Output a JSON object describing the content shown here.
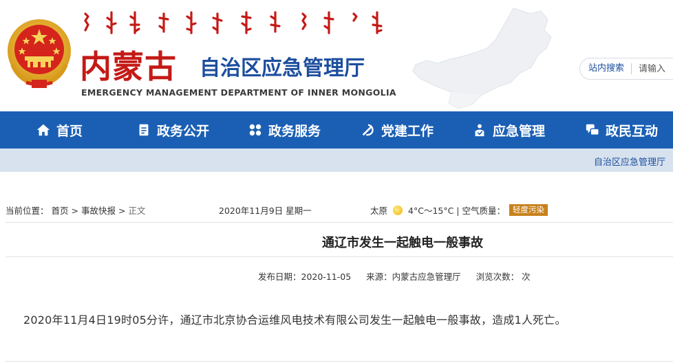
{
  "header": {
    "logo_cn": "内蒙古",
    "logo_sub": "自治区应急管理厅",
    "logo_en": "EMERGENCY MANAGEMENT DEPARTMENT OF INNER MONGOLIA",
    "search_label": "站内搜索",
    "search_placeholder": "请输入"
  },
  "nav": {
    "items": [
      {
        "label": "首页",
        "icon": "home-icon"
      },
      {
        "label": "政务公开",
        "icon": "document-icon"
      },
      {
        "label": "政务服务",
        "icon": "grid-icon"
      },
      {
        "label": "党建工作",
        "icon": "party-emblem-icon"
      },
      {
        "label": "应急管理",
        "icon": "shield-person-icon"
      },
      {
        "label": "政民互动",
        "icon": "chat-icon"
      }
    ]
  },
  "ticker": {
    "text": "自治区应急管理厅"
  },
  "infobar": {
    "location_label": "当前位置：",
    "crumbs": [
      "首页",
      "事故快报",
      "正文"
    ],
    "separator": ">",
    "date": "2020年11月9日 星期一",
    "city": "太原",
    "temperature": "4°C～15°C | 空气质量：",
    "air_quality": "轻度污染",
    "air_quality_color": "#c7811b"
  },
  "article": {
    "title": "通辽市发生一起触电一般事故",
    "publish_date": "发布日期：2020-11-05",
    "source": "来源：内蒙古应急管理厅",
    "views": "浏览次数： 次",
    "body": "2020年11月4日19时05分许，通辽市北京协合运维风电技术有限公司发生一起触电一般事故，造成1人死亡。"
  },
  "colors": {
    "nav_bg": "#1a5fb4",
    "ticker_bg": "#d7e2ee",
    "brand_red": "#c41a16",
    "brand_blue": "#1d4e9e"
  }
}
